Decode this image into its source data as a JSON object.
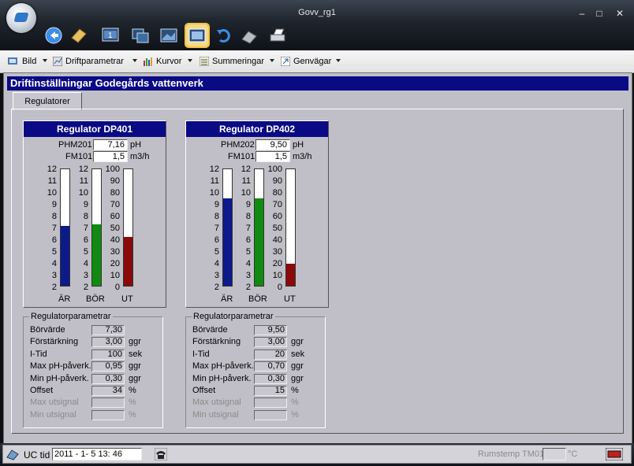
{
  "window": {
    "title": "Govv_rg1",
    "minimize": "–",
    "maximize": "□",
    "close": "✕"
  },
  "toolbar": {
    "icons": [
      "back-icon",
      "note-icon",
      "screen-1-icon",
      "screens-icon",
      "screen-landscape-icon",
      "screen-selected-icon",
      "undo-icon",
      "phone-fax-icon",
      "printer-icon"
    ]
  },
  "menu": {
    "items": [
      "Bild",
      "Driftparametrar",
      "Kurvor",
      "Summeringar",
      "Genvägar"
    ]
  },
  "page": {
    "heading": "Driftinställningar Godegårds vattenverk",
    "tab": "Regulatorer"
  },
  "regulators": [
    {
      "title": "Regulator DP401",
      "sensor1": {
        "tag": "PHM201",
        "value": "7,16",
        "unit": "pH"
      },
      "sensor2": {
        "tag": "FM101",
        "value": "1,5",
        "unit": "m3/h"
      },
      "bar_labels": [
        "ÄR",
        "BÖR",
        "UT"
      ],
      "scale_ph": [
        "12",
        "11",
        "10",
        "9",
        "8",
        "7",
        "6",
        "5",
        "4",
        "3",
        "2"
      ],
      "scale_pct": [
        "100",
        "90",
        "80",
        "70",
        "60",
        "50",
        "40",
        "30",
        "20",
        "10",
        "0"
      ],
      "bar_ar": 0.516,
      "bar_bor": 0.53,
      "bar_ut": 0.42,
      "params_title": "Regulatorparametrar",
      "params": [
        {
          "label": "Börvärde",
          "value": "7,30",
          "unit": "",
          "disabled": false
        },
        {
          "label": "Förstärkning",
          "value": "3,00",
          "unit": "ggr",
          "disabled": false
        },
        {
          "label": "I-Tid",
          "value": "100",
          "unit": "sek",
          "disabled": false
        },
        {
          "label": "Max pH-påverk.",
          "value": "0,95",
          "unit": "ggr",
          "disabled": false
        },
        {
          "label": "Min pH-påverk.",
          "value": "0,30",
          "unit": "ggr",
          "disabled": false
        },
        {
          "label": "Offset",
          "value": "34",
          "unit": "%",
          "disabled": false
        },
        {
          "label": "Max utsignal",
          "value": "",
          "unit": "%",
          "disabled": true
        },
        {
          "label": "Min utsignal",
          "value": "",
          "unit": "%",
          "disabled": true
        }
      ]
    },
    {
      "title": "Regulator DP402",
      "sensor1": {
        "tag": "PHM202",
        "value": "9,50",
        "unit": "pH"
      },
      "sensor2": {
        "tag": "FM101",
        "value": "1,5",
        "unit": "m3/h"
      },
      "bar_labels": [
        "ÄR",
        "BÖR",
        "UT"
      ],
      "scale_ph": [
        "12",
        "11",
        "10",
        "9",
        "8",
        "7",
        "6",
        "5",
        "4",
        "3",
        "2"
      ],
      "scale_pct": [
        "100",
        "90",
        "80",
        "70",
        "60",
        "50",
        "40",
        "30",
        "20",
        "10",
        "0"
      ],
      "bar_ar": 0.75,
      "bar_bor": 0.75,
      "bar_ut": 0.19,
      "params_title": "Regulatorparametrar",
      "params": [
        {
          "label": "Börvärde",
          "value": "9,50",
          "unit": "",
          "disabled": false
        },
        {
          "label": "Förstärkning",
          "value": "3,00",
          "unit": "ggr",
          "disabled": false
        },
        {
          "label": "I-Tid",
          "value": "20",
          "unit": "sek",
          "disabled": false
        },
        {
          "label": "Max pH-påverk.",
          "value": "0,70",
          "unit": "ggr",
          "disabled": false
        },
        {
          "label": "Min pH-påverk.",
          "value": "0,30",
          "unit": "ggr",
          "disabled": false
        },
        {
          "label": "Offset",
          "value": "15",
          "unit": "%",
          "disabled": false
        },
        {
          "label": "Max utsignal",
          "value": "",
          "unit": "%",
          "disabled": true
        },
        {
          "label": "Min utsignal",
          "value": "",
          "unit": "%",
          "disabled": true
        }
      ]
    }
  ],
  "colors": {
    "ar": "#0c1a8a",
    "bor": "#108a10",
    "ut": "#8a0a0a",
    "header": "#0a0a84"
  },
  "status": {
    "uc_label": "UC tid",
    "datetime": "2011 -   1-   5   13: 46",
    "rumstemp_label": "Rumstemp TM01",
    "rumstemp_value": "",
    "rumstemp_unit": "°C"
  }
}
